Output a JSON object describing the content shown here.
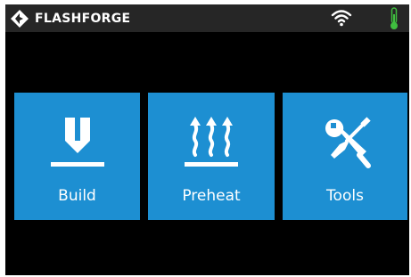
{
  "status_bar": {
    "brand": "FLASHFORGE",
    "logo_icon": "flashforge-diamond-logo",
    "wifi_icon": "wifi-icon",
    "thermometer_icon": "thermometer-icon",
    "thermometer_color": "#3fbf3f"
  },
  "menu": {
    "tiles": [
      {
        "label": "Build",
        "icon": "nozzle-icon"
      },
      {
        "label": "Preheat",
        "icon": "heat-icon"
      },
      {
        "label": "Tools",
        "icon": "tools-icon"
      }
    ],
    "tile_color": "#1d8fd2"
  }
}
